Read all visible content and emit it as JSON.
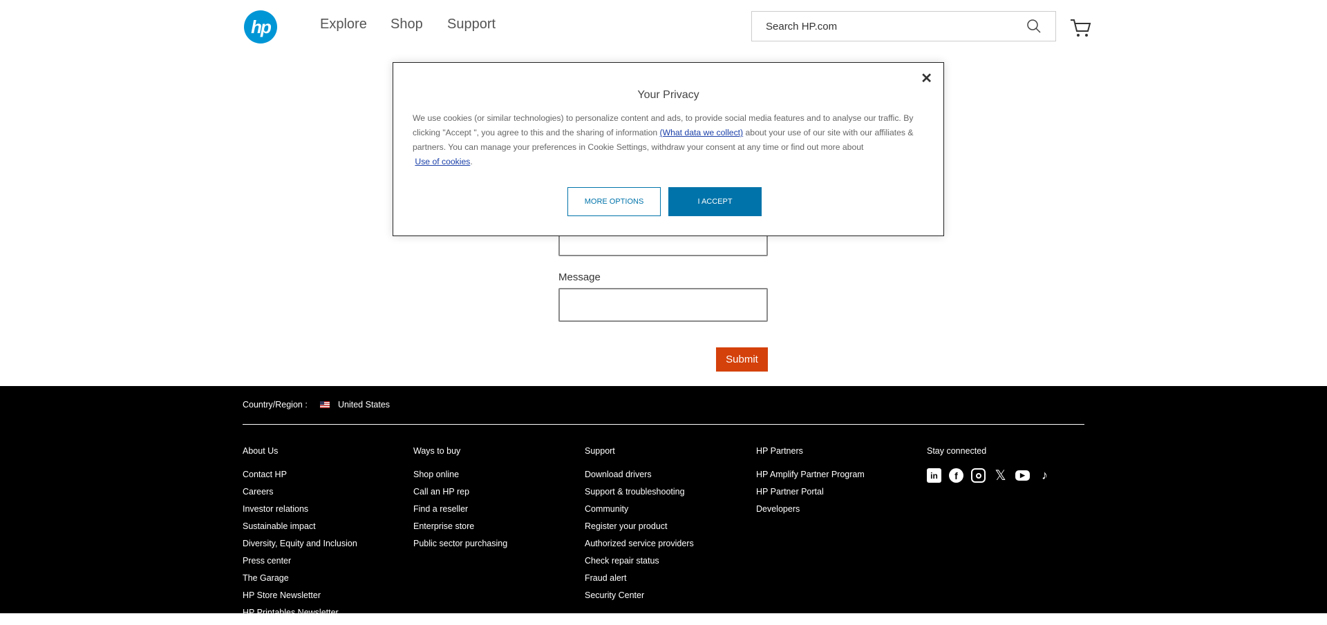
{
  "header": {
    "logo": "hp",
    "nav": [
      "Explore",
      "Shop",
      "Support"
    ],
    "search_placeholder": "Search HP.com"
  },
  "form": {
    "message_label": "Message",
    "submit": "Submit"
  },
  "modal": {
    "title": "Your Privacy",
    "close": "✕",
    "text1": "We use cookies (or similar technologies) to personalize content and ads, to provide social media features and to analyse our traffic. By clicking \"Accept \", you agree to this and the sharing of information ",
    "link1": "(What data we collect)",
    "text2": " about your use of our site with our affiliates & partners. You can manage your preferences in Cookie Settings, withdraw your consent at any time or find out more about ",
    "link2": "Use of cookies",
    "text3": ".",
    "more_options": "MORE OPTIONS",
    "accept": "I ACCEPT"
  },
  "footer": {
    "country_label": "Country/Region :",
    "country": "United States",
    "columns": [
      {
        "title": "About Us",
        "links": [
          "Contact HP",
          "Careers",
          "Investor relations",
          "Sustainable impact",
          "Diversity, Equity and Inclusion",
          "Press center",
          "The Garage",
          "HP Store Newsletter",
          "HP Printables Newsletter"
        ]
      },
      {
        "title": "Ways to buy",
        "links": [
          "Shop online",
          "Call an HP rep",
          "Find a reseller",
          "Enterprise store",
          "Public sector purchasing"
        ]
      },
      {
        "title": "Support",
        "links": [
          "Download drivers",
          "Support & troubleshooting",
          "Community",
          "Register your product",
          "Authorized service providers",
          "Check repair status",
          "Fraud alert",
          "Security Center"
        ]
      },
      {
        "title": "HP Partners",
        "links": [
          "HP Amplify Partner Program",
          "HP Partner Portal",
          "Developers"
        ]
      }
    ],
    "stay_connected": "Stay connected",
    "social": [
      "linkedin-icon",
      "facebook-icon",
      "instagram-icon",
      "x-icon",
      "youtube-icon",
      "tiktok-icon"
    ]
  },
  "colors": {
    "brand": "#0096d6",
    "accept": "#0073aa",
    "submit": "#d4410b"
  }
}
